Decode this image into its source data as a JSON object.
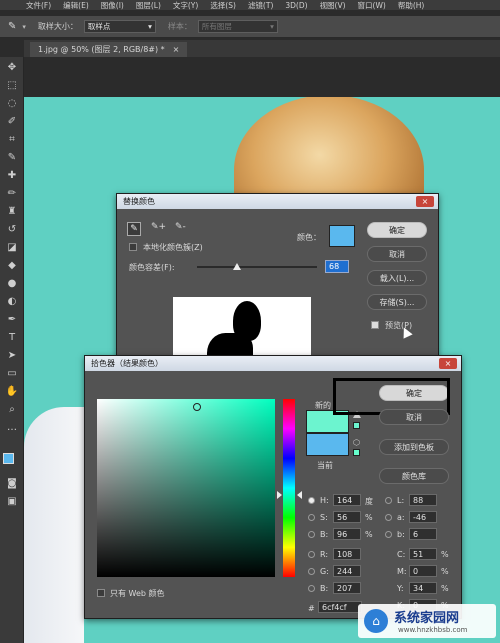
{
  "menubar": {
    "items": [
      "文件(F)",
      "编辑(E)",
      "图像(I)",
      "图层(L)",
      "文字(Y)",
      "选择(S)",
      "滤镜(T)",
      "3D(D)",
      "视图(V)",
      "窗口(W)",
      "帮助(H)"
    ]
  },
  "options_bar": {
    "sample_size_label": "取样大小：",
    "sample_size_value": "取样点",
    "sample_label": "样本：",
    "sample_value": "所有图层"
  },
  "document_tab": {
    "title": "1.jpg @ 50% (图层 2, RGB/8#) *",
    "close": "×"
  },
  "replace_color": {
    "title": "替换颜色",
    "close": "×",
    "localized_label": "本地化颜色簇(Z)",
    "color_label": "颜色：",
    "fuzziness_label": "颜色容差(F):",
    "fuzziness_value": "68",
    "ok": "确定",
    "cancel": "取消",
    "load": "载入(L)...",
    "save": "存储(S)...",
    "preview": "预览(P)",
    "swatch_color": "#5ab8ee"
  },
  "color_picker": {
    "title": "拾色器（结果颜色）",
    "close": "×",
    "new_label": "新的",
    "current_label": "当前",
    "ok": "确定",
    "cancel": "取消",
    "add_swatches": "添加到色板",
    "color_libraries": "颜色库",
    "web_only": "只有 Web 颜色",
    "hsb": [
      {
        "key": "H:",
        "value": "164",
        "unit": "度"
      },
      {
        "key": "S:",
        "value": "56",
        "unit": "%"
      },
      {
        "key": "B:",
        "value": "96",
        "unit": "%"
      }
    ],
    "rgb": [
      {
        "key": "R:",
        "value": "108"
      },
      {
        "key": "G:",
        "value": "244"
      },
      {
        "key": "B:",
        "value": "207"
      }
    ],
    "lab": [
      {
        "key": "L:",
        "value": "88"
      },
      {
        "key": "a:",
        "value": "-46"
      },
      {
        "key": "b:",
        "value": "6"
      }
    ],
    "cmyk": [
      {
        "key": "C:",
        "value": "51",
        "unit": "%"
      },
      {
        "key": "M:",
        "value": "0",
        "unit": "%"
      },
      {
        "key": "Y:",
        "value": "34",
        "unit": "%"
      },
      {
        "key": "K:",
        "value": "0",
        "unit": "%"
      }
    ],
    "hex_label": "#",
    "hex_value": "6cf4cf",
    "new_color": "#6cf4cf",
    "current_color": "#5ab8ee"
  },
  "watermark": {
    "name": "系统家园网",
    "url": "www.hnzkhbsb.com"
  }
}
